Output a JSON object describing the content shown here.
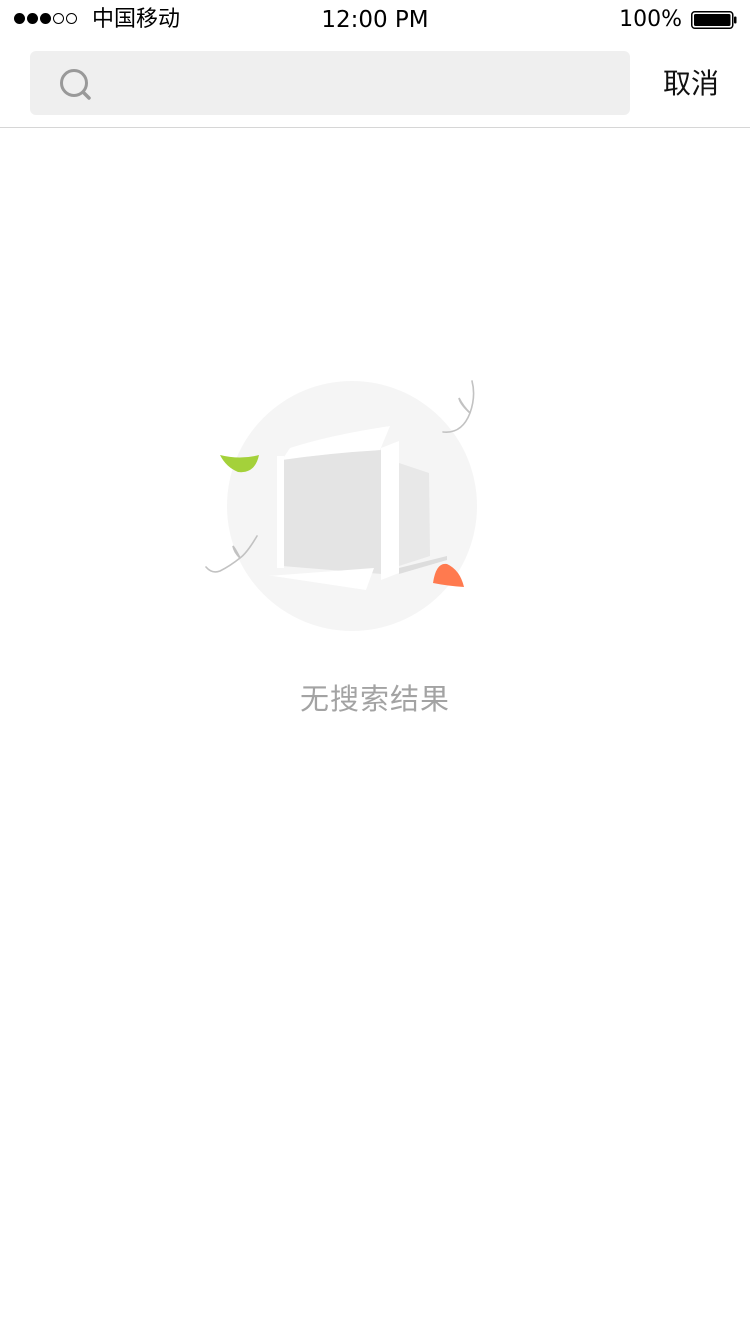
{
  "status_bar": {
    "carrier": "中国移动",
    "time": "12:00 PM",
    "battery_percent": "100%",
    "signal_strength": 3,
    "signal_max": 5
  },
  "search": {
    "placeholder": "",
    "value": "",
    "cancel_label": "取消",
    "icon": "search-icon"
  },
  "empty_state": {
    "message": "无搜索结果",
    "illustration": "empty-box-icon"
  },
  "colors": {
    "search_bg": "#efefef",
    "empty_text": "#a3a3a3",
    "leaf_green": "#9acd32",
    "leaf_orange": "#ff7a4f",
    "circle_bg": "#f5f5f5"
  }
}
